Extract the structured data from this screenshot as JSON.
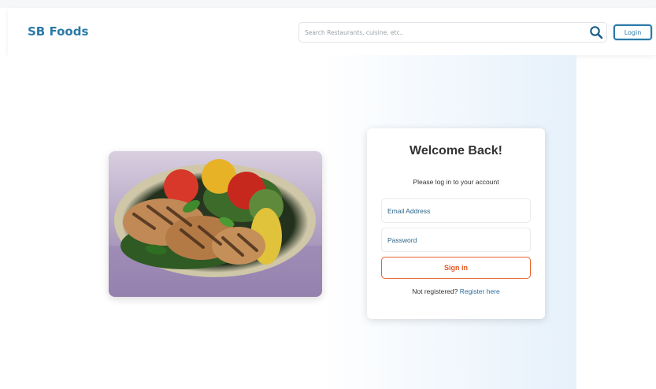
{
  "navbar": {
    "brand": "SB Foods",
    "search_placeholder": "Search Restaurants, cuisine, etc..",
    "login_label": "Login"
  },
  "login_card": {
    "title": "Welcome Back!",
    "subtitle": "Please log in to your account",
    "email_placeholder": "Email Address",
    "password_placeholder": "Password",
    "signin_label": "Sign in",
    "register_prompt": "Not registered? ",
    "register_link": "Register here"
  },
  "icons": {
    "search": "search-icon"
  },
  "colors": {
    "brand": "#2b7aa8",
    "accent": "#e05a24",
    "link": "#2b6ea0"
  }
}
